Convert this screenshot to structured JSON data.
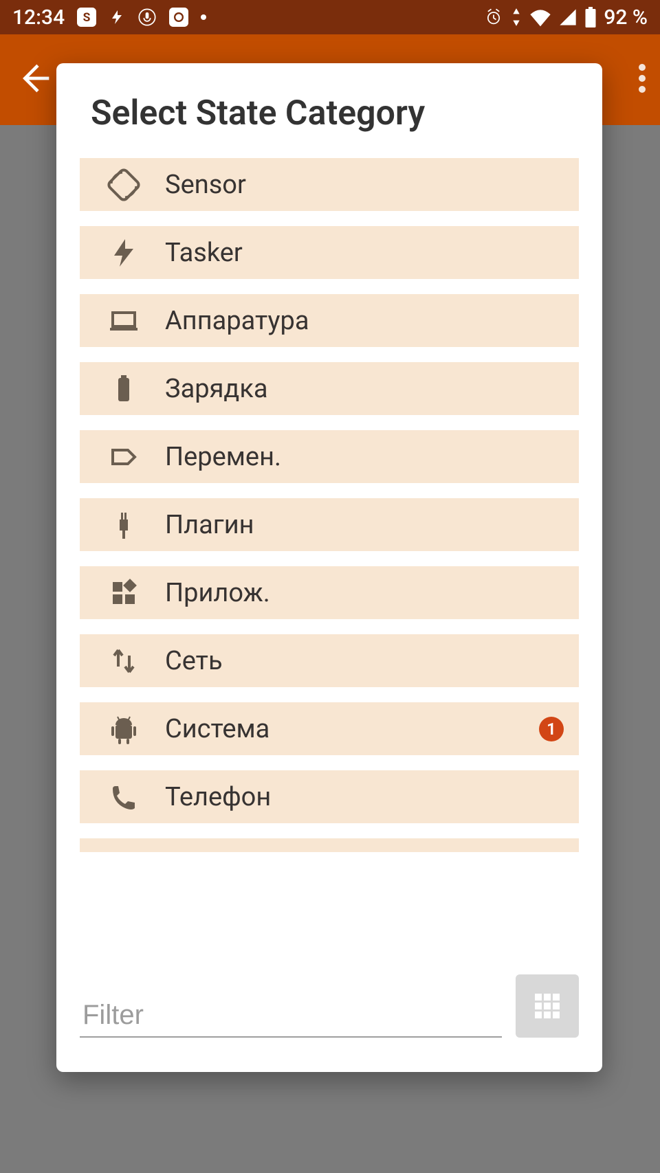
{
  "status": {
    "time": "12:34",
    "battery_pct": "92 %"
  },
  "dialog": {
    "title": "Select State Category",
    "filter_placeholder": "Filter",
    "items": [
      {
        "icon": "rotate-icon",
        "label": "Sensor",
        "badge": null
      },
      {
        "icon": "flash-icon",
        "label": "Tasker",
        "badge": null
      },
      {
        "icon": "laptop-icon",
        "label": "Аппаратура",
        "badge": null
      },
      {
        "icon": "battery-icon",
        "label": "Зарядка",
        "badge": null
      },
      {
        "icon": "tag-icon",
        "label": "Перемен.",
        "badge": null
      },
      {
        "icon": "plug-icon",
        "label": "Плагин",
        "badge": null
      },
      {
        "icon": "apps-icon",
        "label": "Прилож.",
        "badge": null
      },
      {
        "icon": "updown-icon",
        "label": "Сеть",
        "badge": null
      },
      {
        "icon": "android-icon",
        "label": "Система",
        "badge": "1"
      },
      {
        "icon": "phone-icon",
        "label": "Телефон",
        "badge": null
      }
    ]
  }
}
